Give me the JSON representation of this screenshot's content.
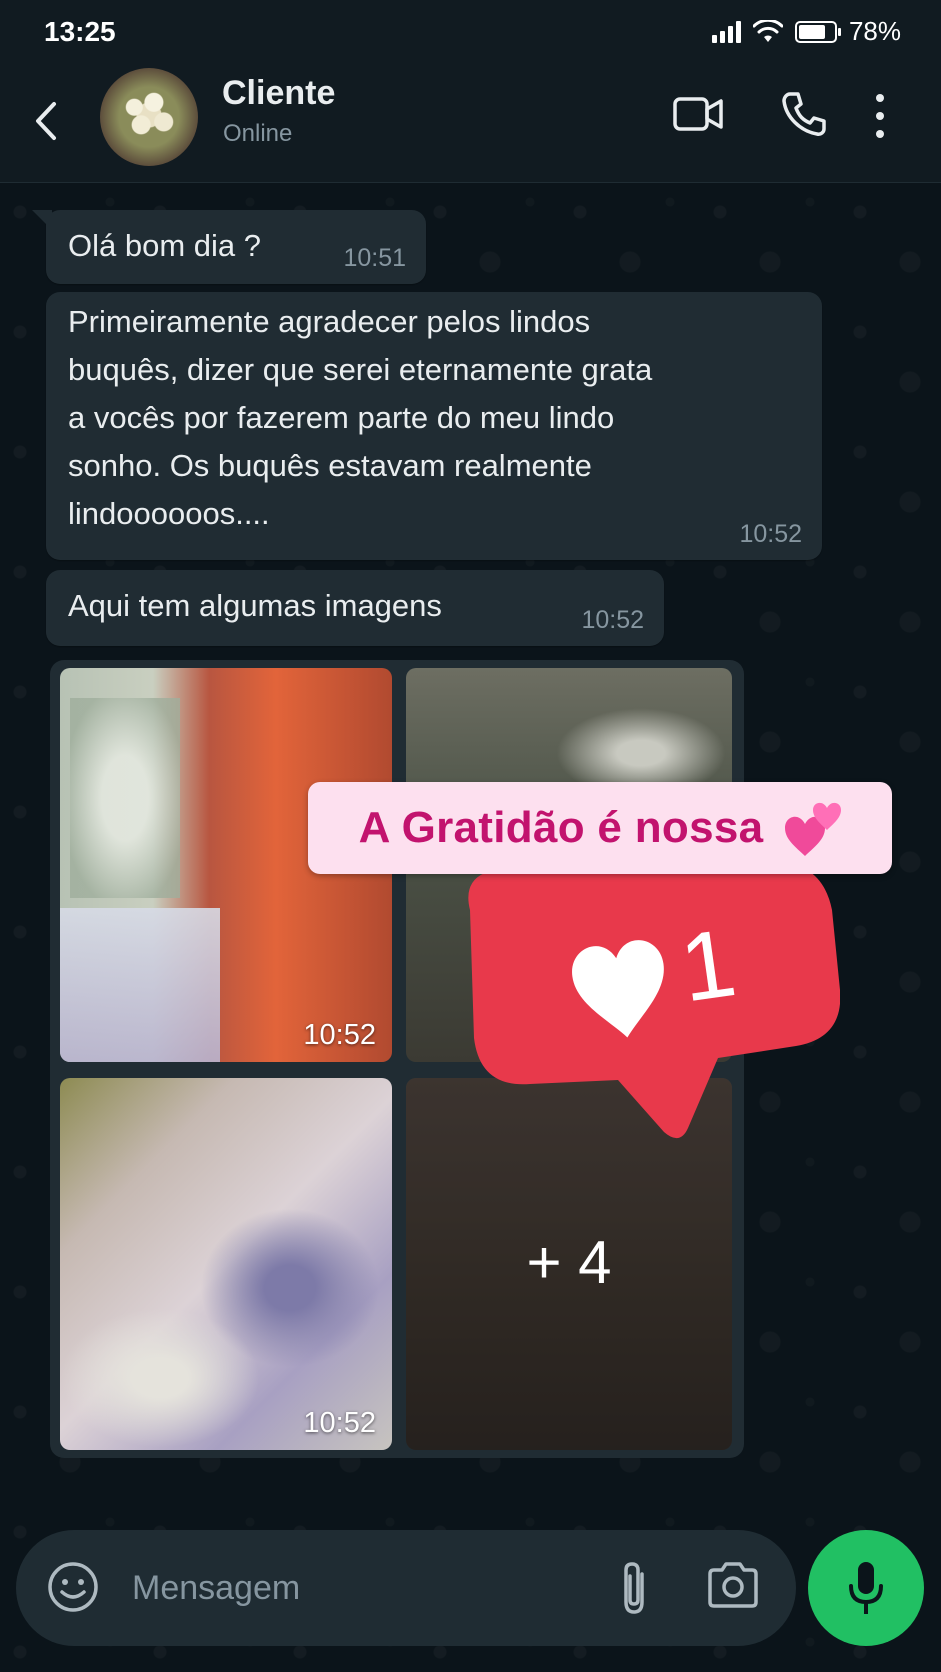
{
  "status_bar": {
    "time": "13:25",
    "battery_percent": "78%",
    "battery_level": 0.78
  },
  "header": {
    "contact_name": "Cliente",
    "contact_status": "Online"
  },
  "messages": [
    {
      "text": "Olá bom dia ?",
      "time": "10:51"
    },
    {
      "lines": [
        "Primeiramente agradecer pelos lindos",
        "buquês, dizer que serei eternamente grata",
        "a vocês por fazerem parte do meu lindo",
        "sonho. Os buquês estavam realmente",
        "lindoooooos...."
      ],
      "time": "10:52"
    },
    {
      "text": "Aqui tem algumas imagens",
      "time": "10:52"
    }
  ],
  "media": {
    "time_top": "10:52",
    "time_bottom": "10:52",
    "more_count": "+ 4"
  },
  "overlay": {
    "banner_text": "A Gratidão é nossa",
    "like_count": "1"
  },
  "input": {
    "placeholder": "Mensagem"
  },
  "colors": {
    "accent": "#21c063",
    "banner_text": "#c2136e",
    "banner_bg": "#fde0ef",
    "like_badge": "#e8394b"
  },
  "icons": [
    "back-arrow-icon",
    "video-call-icon",
    "phone-icon",
    "more-vert-icon",
    "emoji-icon",
    "attach-icon",
    "camera-icon",
    "mic-icon",
    "heart-icon",
    "two-hearts-emoji"
  ]
}
